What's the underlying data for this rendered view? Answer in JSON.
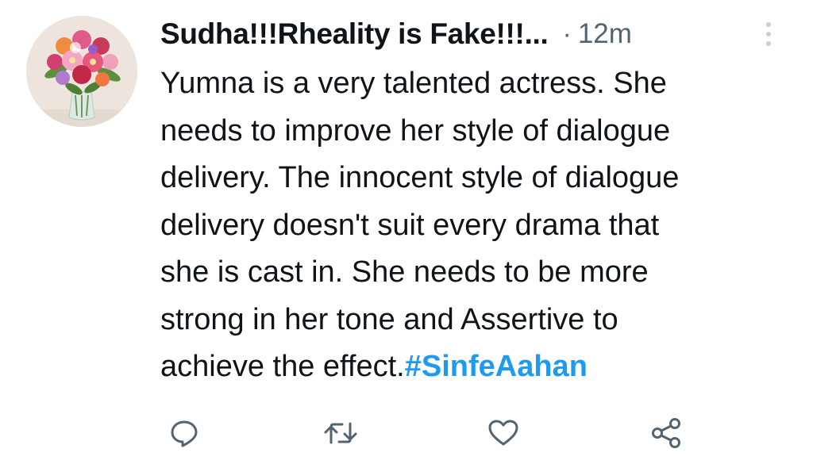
{
  "tweet": {
    "display_name": "Sudha!!!Rheality is Fake!!!...",
    "separator": "·",
    "timestamp": "12m",
    "avatar_icon": "flower-bouquet-avatar",
    "body_lines": [
      "Yumna is a very talented actress. She",
      "needs to improve her style of dialogue",
      "delivery. The innocent style of dialogue",
      "delivery doesn't suit every drama that",
      "she is cast in. She needs to be more",
      "strong in her tone and Assertive to",
      "achieve the effect."
    ],
    "hashtag": "#SinfeAahan",
    "more_icon": "more-vertical-icon",
    "actions": [
      {
        "name": "reply",
        "icon": "reply-icon"
      },
      {
        "name": "retweet",
        "icon": "retweet-icon"
      },
      {
        "name": "like",
        "icon": "heart-icon"
      },
      {
        "name": "share",
        "icon": "share-icon"
      }
    ]
  },
  "colors": {
    "text": "#0f1419",
    "secondary": "#536471",
    "hashtag": "#1d9bf0",
    "background": "#ffffff"
  }
}
